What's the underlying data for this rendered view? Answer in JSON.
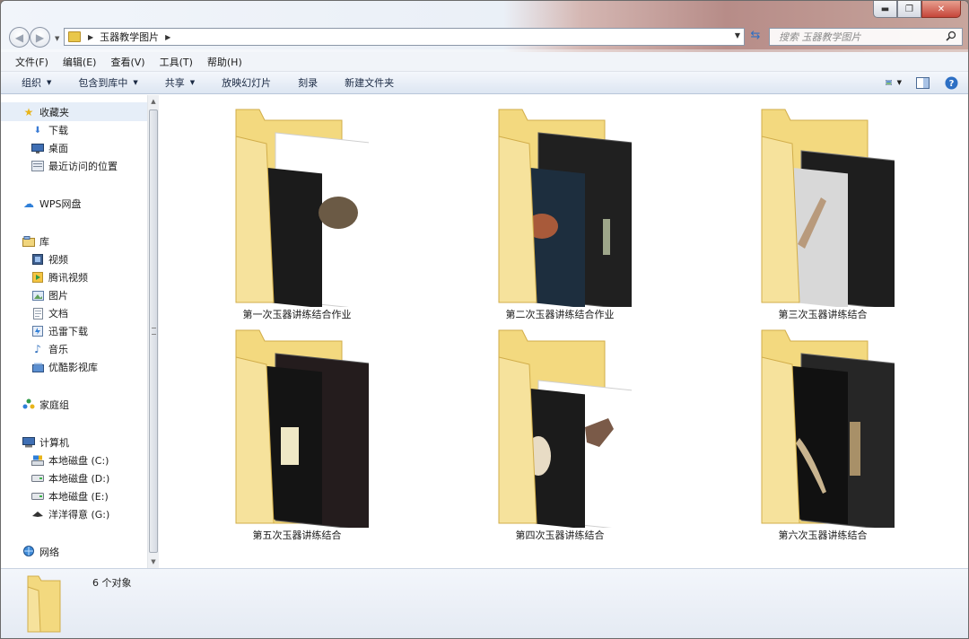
{
  "window": {
    "controls": {
      "minimize": "▬",
      "maximize": "❐",
      "close": "✕"
    }
  },
  "address": {
    "path": "玉器教学图片"
  },
  "search": {
    "placeholder": "搜索 玉器教学图片"
  },
  "menu": [
    "文件(F)",
    "编辑(E)",
    "查看(V)",
    "工具(T)",
    "帮助(H)"
  ],
  "toolbar": {
    "organize": "组织",
    "include": "包含到库中",
    "share": "共享",
    "slideshow": "放映幻灯片",
    "burn": "刻录",
    "new_folder": "新建文件夹"
  },
  "sidebar": {
    "favorites": {
      "label": "收藏夹",
      "items": [
        "下载",
        "桌面",
        "最近访问的位置"
      ]
    },
    "wps": "WPS网盘",
    "libraries": {
      "label": "库",
      "items": [
        "视频",
        "腾讯视频",
        "图片",
        "文档",
        "迅雷下载",
        "音乐",
        "优酷影视库"
      ]
    },
    "homegroup": "家庭组",
    "computer": {
      "label": "计算机",
      "items": [
        "本地磁盘 (C:)",
        "本地磁盘 (D:)",
        "本地磁盘 (E:)",
        "洋洋得意 (G:)"
      ]
    },
    "network": "网络"
  },
  "folders": [
    {
      "name": "第一次玉器讲练结合作业",
      "theme": "white"
    },
    {
      "name": "第二次玉器讲练结合作业",
      "theme": "dark"
    },
    {
      "name": "第三次玉器讲练结合",
      "theme": "gray"
    },
    {
      "name": "第五次玉器讲练结合",
      "theme": "dark"
    },
    {
      "name": "第四次玉器讲练结合",
      "theme": "white"
    },
    {
      "name": "第六次玉器讲练结合",
      "theme": "dark"
    }
  ],
  "status": {
    "count": "6 个对象"
  },
  "colors": {
    "folder": "#f4d77c",
    "accent": "#2d6fc4",
    "selected": "#e6eef8"
  }
}
